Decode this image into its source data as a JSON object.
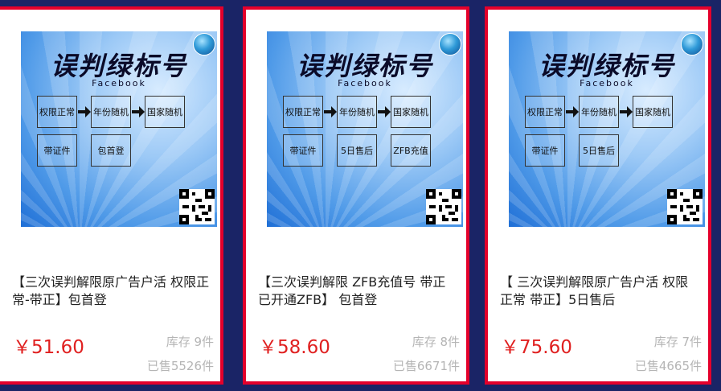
{
  "products": [
    {
      "image": {
        "title": "误判绿标号",
        "subtitle": "Facebook",
        "boxes": [
          "权限正常",
          "年份随机",
          "国家随机",
          "带证件",
          "包首登"
        ]
      },
      "name": "【三次误判解限原广告户活 权限正常-带正】包首登",
      "price": "￥51.60",
      "stock": "库存 9件",
      "sold": "已售5526件"
    },
    {
      "image": {
        "title": "误判绿标号",
        "subtitle": "Facebook",
        "boxes": [
          "权限正常",
          "年份随机",
          "国家随机",
          "带证件",
          "5日售后",
          "ZFB充值"
        ]
      },
      "name": "【三次误判解限 ZFB充值号 带正已开通ZFB】 包首登",
      "price": "￥58.60",
      "stock": "库存 8件",
      "sold": "已售6671件"
    },
    {
      "image": {
        "title": "误判绿标号",
        "subtitle": "Facebook",
        "boxes": [
          "权限正常",
          "年份随机",
          "国家随机",
          "带证件",
          "5日售后"
        ]
      },
      "name": "【 三次误判解限原广告户活 权限正常 带正】5日售后",
      "price": "￥75.60",
      "stock": "库存 7件",
      "sold": "已售4665件"
    }
  ],
  "colors": {
    "border": "#e4002b",
    "price": "#e02020",
    "muted": "#b5b5b5",
    "background": "#1a2466"
  }
}
